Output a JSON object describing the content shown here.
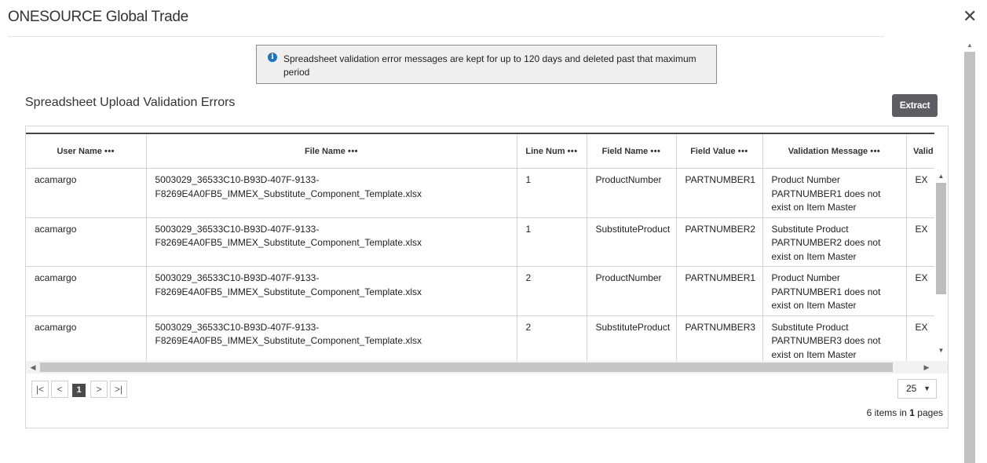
{
  "app": {
    "title": "ONESOURCE Global Trade",
    "close_label": "✕"
  },
  "notice": {
    "icon": "info-icon",
    "text": "Spreadsheet validation error messages are kept for up to 120 days and deleted past that maximum period"
  },
  "section": {
    "title": "Spreadsheet Upload Validation Errors",
    "extract_label": "Extract"
  },
  "grid": {
    "columns": [
      {
        "label": "User Name",
        "menu": "•••"
      },
      {
        "label": "File Name",
        "menu": "•••"
      },
      {
        "label": "Line Num",
        "menu": "•••"
      },
      {
        "label": "Field Name",
        "menu": "•••"
      },
      {
        "label": "Field Value",
        "menu": "•••"
      },
      {
        "label": "Validation Message",
        "menu": "•••"
      },
      {
        "label": "Valid Cod",
        "menu": ""
      }
    ],
    "rows": [
      {
        "user": "acamargo",
        "file_line1": "5003029_36533C10-B93D-407F-9133-",
        "file_line2": "F8269E4A0FB5_IMMEX_Substitute_Component_Template.xlsx",
        "line": "1",
        "field": "ProductNumber",
        "value": "PARTNUMBER1",
        "msg1": "Product Number",
        "msg2": "PARTNUMBER1 does not",
        "msg3": "exist on Item Master",
        "code": "EX"
      },
      {
        "user": "acamargo",
        "file_line1": "5003029_36533C10-B93D-407F-9133-",
        "file_line2": "F8269E4A0FB5_IMMEX_Substitute_Component_Template.xlsx",
        "line": "1",
        "field": "SubstituteProduct",
        "value": "PARTNUMBER2",
        "msg1": "Substitute Product",
        "msg2": "PARTNUMBER2 does not",
        "msg3": "exist on Item Master",
        "code": "EX"
      },
      {
        "user": "acamargo",
        "file_line1": "5003029_36533C10-B93D-407F-9133-",
        "file_line2": "F8269E4A0FB5_IMMEX_Substitute_Component_Template.xlsx",
        "line": "2",
        "field": "ProductNumber",
        "value": "PARTNUMBER1",
        "msg1": "Product Number",
        "msg2": "PARTNUMBER1 does not",
        "msg3": "exist on Item Master",
        "code": "EX"
      },
      {
        "user": "acamargo",
        "file_line1": "5003029_36533C10-B93D-407F-9133-",
        "file_line2": "F8269E4A0FB5_IMMEX_Substitute_Component_Template.xlsx",
        "line": "2",
        "field": "SubstituteProduct",
        "value": "PARTNUMBER3",
        "msg1": "Substitute Product",
        "msg2": "PARTNUMBER3 does not",
        "msg3": "exist on Item Master",
        "code": "EX"
      }
    ]
  },
  "pager": {
    "first": "|<",
    "prev": "<",
    "current": "1",
    "next": ">",
    "last": ">|",
    "page_size": "25",
    "info_prefix": "6 items in",
    "info_pages": "1",
    "info_suffix": "pages"
  }
}
